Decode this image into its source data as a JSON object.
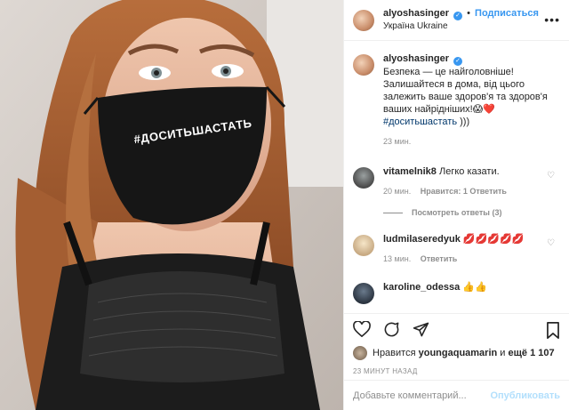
{
  "header": {
    "username": "alyoshasinger",
    "follow_label": "Подписаться",
    "location": "Україна Ukraine",
    "more_icon": "more-options-icon"
  },
  "photo": {
    "mask_text": "#ДОСИТЬШАСТАТЬ"
  },
  "caption": {
    "username": "alyoshasinger",
    "text": "Безпека — це найголовніше! Залишайтеся в дома, від цього залежить ваше здоров'я та здоров'я ваших найрідніших!",
    "emoji": "😱❤️",
    "hashtag": "#доситьшастать",
    "suffix": " )))",
    "time": "23 мин."
  },
  "comments": [
    {
      "username": "vitamelnik8",
      "text": "Легко казати.",
      "time": "20 мин.",
      "likes": "Нравится: 1",
      "reply": "Ответить",
      "view_replies": "Посмотреть ответы (3)"
    },
    {
      "username": "ludmilaseredyuk",
      "text": "💋💋💋💋💋",
      "time": "13 мин.",
      "reply": "Ответить"
    },
    {
      "username": "karoline_odessa",
      "text": "👍👍"
    }
  ],
  "likes": {
    "prefix": "Нравится",
    "user": "youngaquamarin",
    "middle": "и",
    "count": "ещё 1 107"
  },
  "post_time": "23 МИНУТ НАЗАД",
  "add_comment": {
    "placeholder": "Добавьте комментарий...",
    "publish_label": "Опубликовать"
  },
  "colors": {
    "link_blue": "#3897f0",
    "muted_gray": "#8e8e8e",
    "mask_black": "#161616"
  }
}
